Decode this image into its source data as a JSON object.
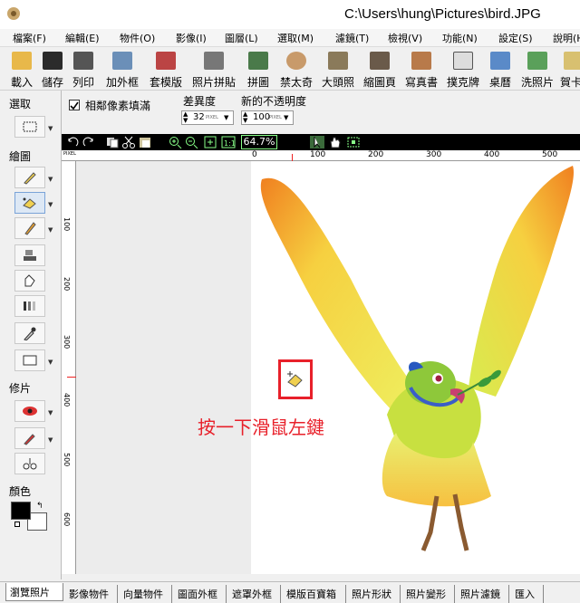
{
  "window": {
    "title": "C:\\Users\\hung\\Pictures\\bird.JPG"
  },
  "menu": [
    "檔案(F)",
    "編輯(E)",
    "物件(O)",
    "影像(I)",
    "圖層(L)",
    "選取(M)",
    "濾鏡(T)",
    "檢視(V)",
    "功能(N)",
    "設定(S)",
    "說明(H)"
  ],
  "toolbar": [
    "載入",
    "儲存",
    "列印",
    "加外框",
    "套模版",
    "照片拼貼",
    "拼圖",
    "禁太奇",
    "大頭照",
    "縮圖頁",
    "寫真書",
    "撲克牌",
    "桌曆",
    "洗照片",
    "賀卡"
  ],
  "left_panel": {
    "select_label": "選取",
    "draw_label": "繪圖",
    "retouch_label": "修片",
    "color_label": "顏色"
  },
  "options": {
    "antialias_checkbox_label": "相鄰像素填滿",
    "antialias_checked": true,
    "tolerance_label": "差異度",
    "tolerance_value": "32",
    "tolerance_unit": "PIXEL",
    "opacity_label": "新的不透明度",
    "opacity_value": "100",
    "opacity_unit": "PIXEL"
  },
  "view": {
    "zoom": "64.7%"
  },
  "ruler": {
    "top_ticks": [
      "0",
      "100",
      "200",
      "300",
      "400",
      "500"
    ],
    "left_ticks": [
      "100",
      "200",
      "300",
      "400",
      "500",
      "600"
    ],
    "corner": "PIXEL"
  },
  "annotation": {
    "text": "按一下滑鼠左鍵",
    "color": "#e8202a"
  },
  "tabs": [
    "瀏覽照片",
    "影像物件",
    "向量物件",
    "圖面外框",
    "遮罩外框",
    "模版百寶箱",
    "照片形狀",
    "照片變形",
    "照片濾鏡",
    "匯入"
  ],
  "colors": {
    "foreground": "#000000",
    "background": "#ffffff",
    "accent": "#e8202a"
  }
}
